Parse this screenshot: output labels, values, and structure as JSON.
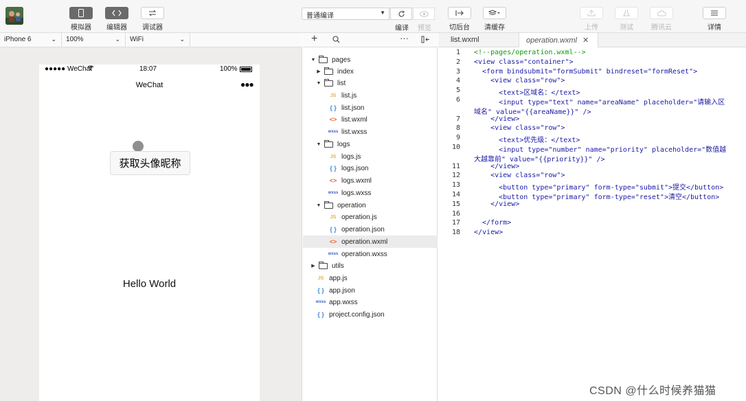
{
  "toolbar": {
    "simulator_label": "模拟器",
    "editor_label": "编辑器",
    "debugger_label": "调试器",
    "compile_mode": "普通编译",
    "compile_label": "编译",
    "preview_label": "预览",
    "background_label": "切后台",
    "clear_cache_label": "清缓存",
    "upload_label": "上传",
    "test_label": "测试",
    "tencent_cloud_label": "腾讯云",
    "details_label": "详情"
  },
  "device_bar": {
    "device": "iPhone 6",
    "zoom": "100%",
    "network": "WiFi"
  },
  "simulator": {
    "status_carrier": "●●●●● WeChat",
    "status_time": "18:07",
    "status_battery": "100%",
    "nav_title": "WeChat",
    "nav_more": "●●●",
    "nickname_button": "获取头像昵称",
    "hello_text": "Hello World"
  },
  "tree": {
    "items": [
      {
        "label": "pages"
      },
      {
        "label": "index"
      },
      {
        "label": "list"
      },
      {
        "label": "list.js"
      },
      {
        "label": "list.json"
      },
      {
        "label": "list.wxml"
      },
      {
        "label": "list.wxss"
      },
      {
        "label": "logs"
      },
      {
        "label": "logs.js"
      },
      {
        "label": "logs.json"
      },
      {
        "label": "logs.wxml"
      },
      {
        "label": "logs.wxss"
      },
      {
        "label": "operation"
      },
      {
        "label": "operation.js"
      },
      {
        "label": "operation.json"
      },
      {
        "label": "operation.wxml"
      },
      {
        "label": "operation.wxss"
      },
      {
        "label": "utils"
      },
      {
        "label": "app.js"
      },
      {
        "label": "app.json"
      },
      {
        "label": "app.wxss"
      },
      {
        "label": "project.config.json"
      }
    ],
    "type_labels": {
      "js": "JS",
      "json": "{ }",
      "wxml": "<>",
      "wxss": "wxss"
    }
  },
  "editor": {
    "tabs": [
      {
        "label": "list.wxml"
      },
      {
        "label": "operation.wxml"
      }
    ],
    "line_numbers": [
      "1",
      "2",
      "3",
      "4",
      "5",
      "6",
      "7",
      "8",
      "9",
      "10",
      "11",
      "12",
      "13",
      "14",
      "15",
      "16",
      "17",
      "18"
    ],
    "lines": [
      "<!--pages/operation.wxml-->",
      "<view class=\"container\">",
      "  <form bindsubmit=\"formSubmit\" bindreset=\"formReset\">",
      "    <view class=\"row\">",
      "      <text>区域名：</text>",
      "      <input type=\"text\" name=\"areaName\" placeholder=\"请输入区",
      "域名\" value=\"{{areaName}}\" />",
      "    </view>",
      "    <view class=\"row\">",
      "      <text>优先级：</text>",
      "      <input type=\"number\" name=\"priority\" placeholder=\"数值越",
      "大越靠前\" value=\"{{priority}}\" />",
      "    </view>",
      "    <view class=\"row\">",
      "      <button type=\"primary\" form-type=\"submit\">提交</button>",
      "      <button type=\"primary\" form-type=\"reset\">清空</button>",
      "    </view>",
      "",
      "  </form>",
      "</view>"
    ]
  },
  "watermark": "CSDN @什么时候养猫猫"
}
